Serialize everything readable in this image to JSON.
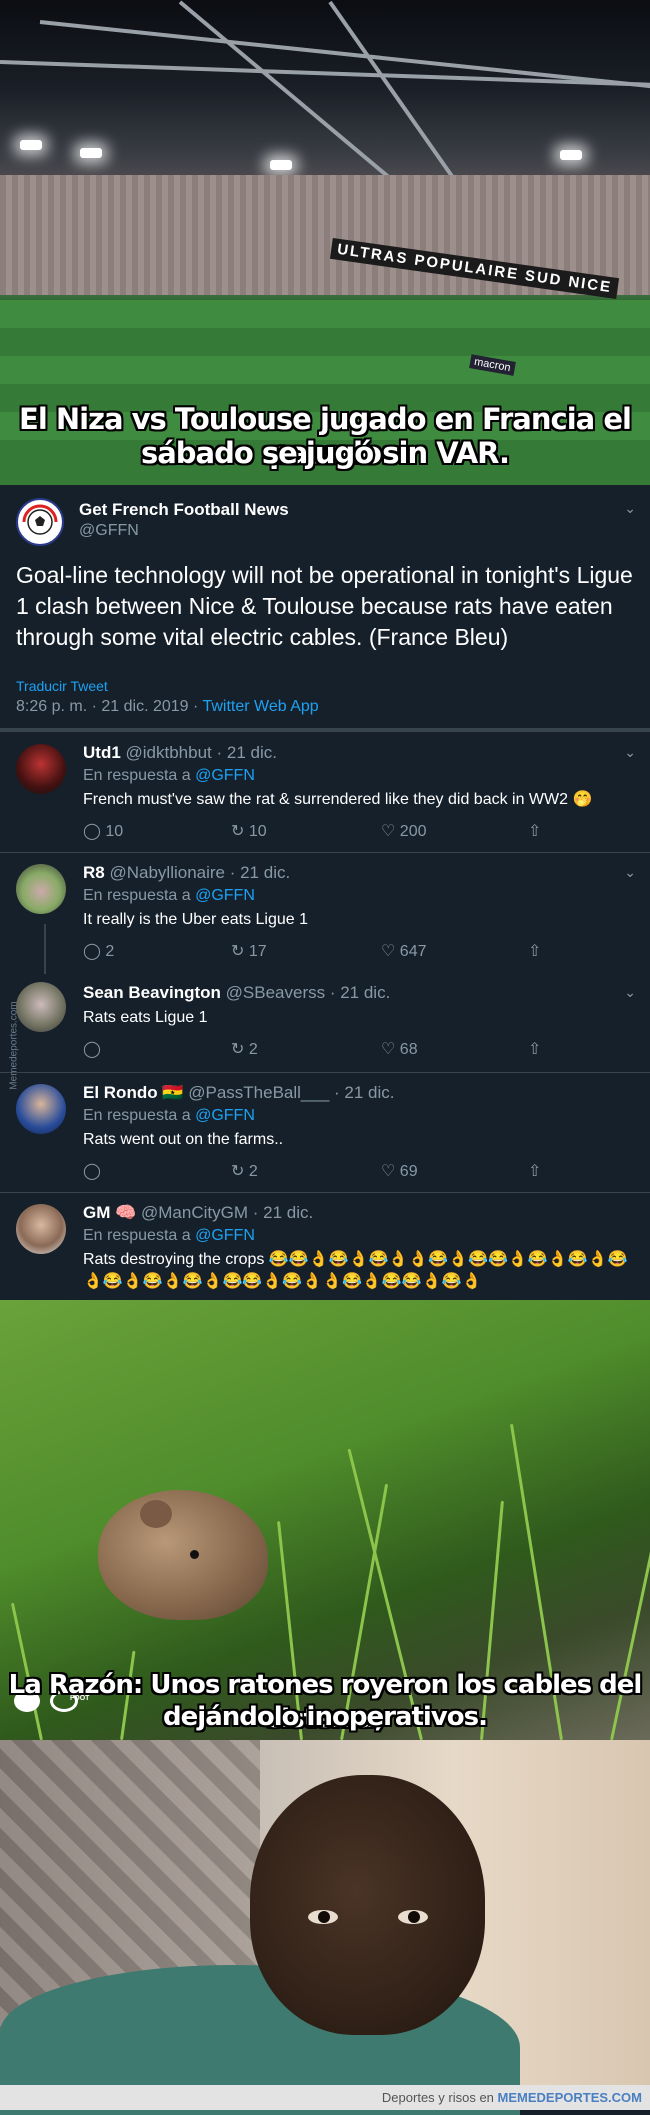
{
  "stadium": {
    "banner": "ULTRAS POPULAIRE SUD NICE",
    "ad_text": "macron",
    "caption_line1": "El Niza vs Toulouse jugado en Francia el pasado",
    "caption_line2": "sábado se jugó sin VAR."
  },
  "tweet": {
    "author_name": "Get French Football News",
    "author_handle": "@GFFN",
    "text": "Goal-line technology will not be operational in tonight's Ligue 1 clash between Nice & Toulouse because rats have eaten through some vital electric cables. (France Bleu)",
    "translate_label": "Traducir Tweet",
    "time": "8:26 p. m. · 21 dic. 2019 · ",
    "source": "Twitter Web App"
  },
  "replies": [
    {
      "name": "Utd1",
      "handle": "@idktbhbut · 21 dic.",
      "reply_prefix": "En respuesta a ",
      "reply_to": "@GFFN",
      "text": "French must've saw the rat & surrendered like they did back in WW2 🤭",
      "comments": "10",
      "retweets": "10",
      "likes": "200"
    },
    {
      "name": "R8",
      "handle": "@Nabyllionaire · 21 dic.",
      "reply_prefix": "En respuesta a ",
      "reply_to": "@GFFN",
      "text": "It really is the Uber eats Ligue 1",
      "comments": "2",
      "retweets": "17",
      "likes": "647"
    },
    {
      "name": "Sean Beavington",
      "handle": "@SBeaverss · 21 dic.",
      "text": "Rats eats Ligue 1",
      "retweets": "2",
      "likes": "68"
    },
    {
      "name": "El Rondo 🇬🇭",
      "handle": "@PassTheBall___ · 21 dic.",
      "reply_prefix": "En respuesta a ",
      "reply_to": "@GFFN",
      "text": "Rats went out on the farms..",
      "retweets": "2",
      "likes": "69"
    },
    {
      "name": "GM 🧠",
      "handle": "@ManCityGM · 21 dic.",
      "reply_prefix": "En respuesta a ",
      "reply_to": "@GFFN",
      "text": "Rats destroying the crops 😂😂👌😂👌😂👌👌😂👌😂😂👌😂👌😂👌😂👌😂👌😂👌😂👌😂😂👌😂👌👌😂👌😂😂👌😂👌"
    }
  ],
  "side_watermark": "Memedeportes.com",
  "mouse": {
    "caption_line1": "La Razón: Unos ratones royeron los cables del sistema,",
    "caption_line2": "dejándolo inoperativos.",
    "logo_text": "FOOT"
  },
  "footer": {
    "prefix": "Deportes y risos en ",
    "site": "MEMEDEPORTES.COM"
  }
}
